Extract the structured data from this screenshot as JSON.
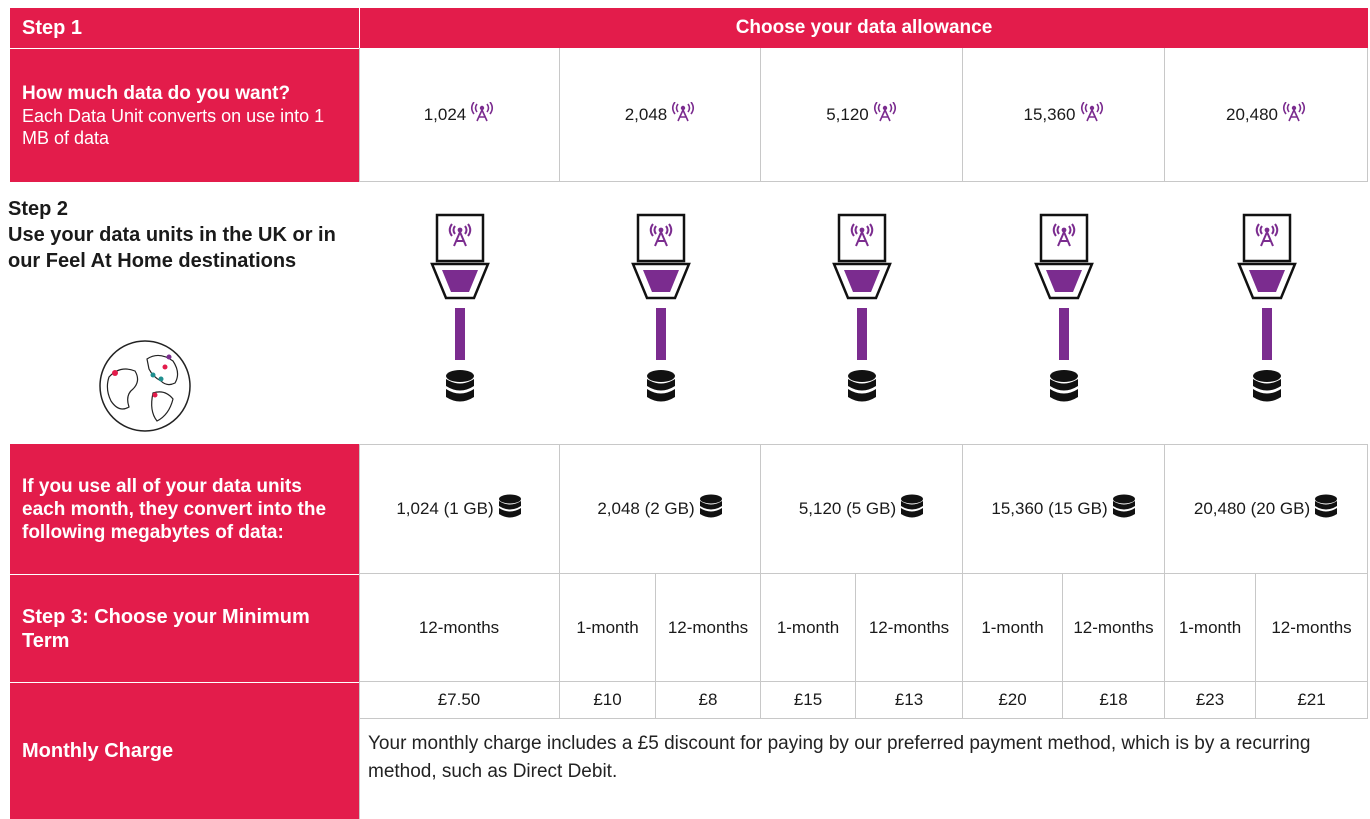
{
  "colors": {
    "brand": "#e31c4b",
    "accent": "#7b2c8f",
    "db": "#111111"
  },
  "step1": {
    "label": "Step 1",
    "header": "Choose your data allowance",
    "question": "How much data do you want?",
    "note": "Each Data Unit converts on use into 1 MB of data",
    "units": [
      "1,024",
      "2,048",
      "5,120",
      "15,360",
      "20,480"
    ],
    "icon": "antenna-icon"
  },
  "step2": {
    "label": "Step 2",
    "text": "Use your data units in the UK or in our Feel At Home destinations",
    "globe_icon": "globe-icon",
    "converter_icon": "data-converter-icon",
    "database_icon": "database-icon"
  },
  "conversion": {
    "label": "If you use all of your data units each month, they convert into the following megabytes of data:",
    "values": [
      "1,024 (1 GB)",
      "2,048 (2 GB)",
      "5,120 (5 GB)",
      "15,360 (15 GB)",
      "20,480 (20 GB)"
    ]
  },
  "step3": {
    "label": "Step 3: Choose your Minimum Term",
    "terms": [
      "12-months",
      "1-month",
      "12-months",
      "1-month",
      "12-months",
      "1-month",
      "12-months",
      "1-month",
      "12-months"
    ]
  },
  "charge": {
    "label": "Monthly Charge",
    "prices": [
      "£7.50",
      "£10",
      "£8",
      "£15",
      "£13",
      "£20",
      "£18",
      "£23",
      "£21"
    ],
    "note": "Your monthly charge includes a £5 discount for paying by our preferred payment method, which is by a recurring method, such as Direct Debit."
  }
}
